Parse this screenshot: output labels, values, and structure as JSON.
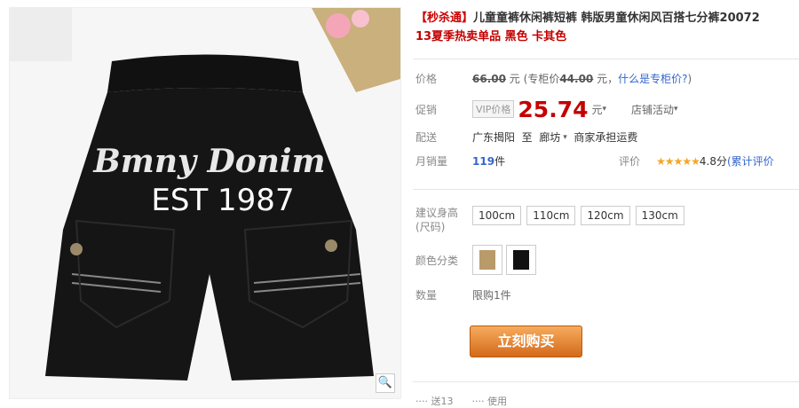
{
  "product": {
    "title_tag": "【秒杀通】",
    "title": "儿童童裤休闲裤短裤 韩版男童休闲风百搭七分裤20072",
    "subtitle": "13夏季热卖单品 黑色 卡其色",
    "image_text_1": "Bmny Donim",
    "image_text_2": "EST 1987",
    "zoom_icon": "magnifier-icon"
  },
  "price": {
    "label": "价格",
    "original": "66.00",
    "currency_after": "元",
    "counter_prefix": "(专柜价",
    "counter_value": "44.00",
    "counter_suffix": "元，",
    "what_is": "什么是专柜价?",
    "close_paren": ")"
  },
  "promo": {
    "label": "促销",
    "vip": "VIP价格",
    "price": "25.74",
    "unit": "元",
    "activity": "店铺活动"
  },
  "delivery": {
    "label": "配送",
    "from": "广东揭阳",
    "to_word": "至",
    "dest": "廊坊",
    "fee": "商家承担运费"
  },
  "sales": {
    "label": "月销量",
    "count": "119",
    "unit": "件",
    "rating_label": "评价",
    "stars": "★★★★★",
    "score": "4.8分",
    "acc": "(累计评价"
  },
  "options": {
    "height_label": "建议身高(尺码)",
    "sizes": [
      "100cm",
      "110cm",
      "120cm",
      "130cm"
    ],
    "color_label": "颜色分类",
    "qty_label": "数量",
    "limit": "限购1件"
  },
  "buy_button": "立刻购买",
  "bottom": {
    "a": "····  送13",
    "b": "····  使用"
  },
  "colors": {
    "price_red": "#c40000",
    "buy_orange": "#e07a2a"
  }
}
